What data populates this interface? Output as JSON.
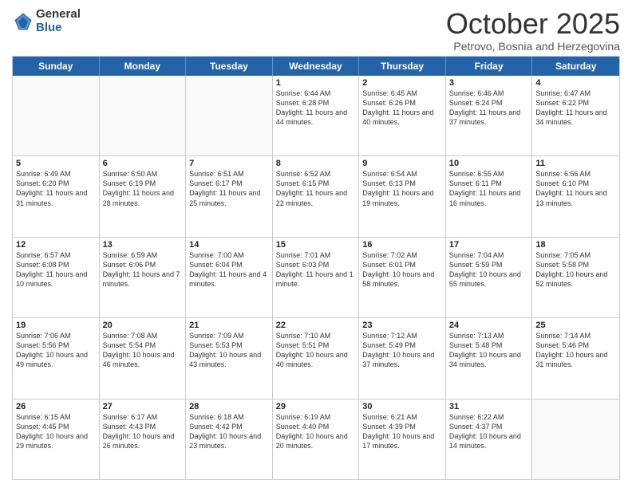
{
  "logo": {
    "general": "General",
    "blue": "Blue"
  },
  "header": {
    "month": "October 2025",
    "location": "Petrovo, Bosnia and Herzegovina"
  },
  "days": [
    "Sunday",
    "Monday",
    "Tuesday",
    "Wednesday",
    "Thursday",
    "Friday",
    "Saturday"
  ],
  "weeks": [
    [
      {
        "day": "",
        "text": ""
      },
      {
        "day": "",
        "text": ""
      },
      {
        "day": "",
        "text": ""
      },
      {
        "day": "1",
        "text": "Sunrise: 6:44 AM\nSunset: 6:28 PM\nDaylight: 11 hours and 44 minutes."
      },
      {
        "day": "2",
        "text": "Sunrise: 6:45 AM\nSunset: 6:26 PM\nDaylight: 11 hours and 40 minutes."
      },
      {
        "day": "3",
        "text": "Sunrise: 6:46 AM\nSunset: 6:24 PM\nDaylight: 11 hours and 37 minutes."
      },
      {
        "day": "4",
        "text": "Sunrise: 6:47 AM\nSunset: 6:22 PM\nDaylight: 11 hours and 34 minutes."
      }
    ],
    [
      {
        "day": "5",
        "text": "Sunrise: 6:49 AM\nSunset: 6:20 PM\nDaylight: 11 hours and 31 minutes."
      },
      {
        "day": "6",
        "text": "Sunrise: 6:50 AM\nSunset: 6:19 PM\nDaylight: 11 hours and 28 minutes."
      },
      {
        "day": "7",
        "text": "Sunrise: 6:51 AM\nSunset: 6:17 PM\nDaylight: 11 hours and 25 minutes."
      },
      {
        "day": "8",
        "text": "Sunrise: 6:52 AM\nSunset: 6:15 PM\nDaylight: 11 hours and 22 minutes."
      },
      {
        "day": "9",
        "text": "Sunrise: 6:54 AM\nSunset: 6:13 PM\nDaylight: 11 hours and 19 minutes."
      },
      {
        "day": "10",
        "text": "Sunrise: 6:55 AM\nSunset: 6:11 PM\nDaylight: 11 hours and 16 minutes."
      },
      {
        "day": "11",
        "text": "Sunrise: 6:56 AM\nSunset: 6:10 PM\nDaylight: 11 hours and 13 minutes."
      }
    ],
    [
      {
        "day": "12",
        "text": "Sunrise: 6:57 AM\nSunset: 6:08 PM\nDaylight: 11 hours and 10 minutes."
      },
      {
        "day": "13",
        "text": "Sunrise: 6:59 AM\nSunset: 6:06 PM\nDaylight: 11 hours and 7 minutes."
      },
      {
        "day": "14",
        "text": "Sunrise: 7:00 AM\nSunset: 6:04 PM\nDaylight: 11 hours and 4 minutes."
      },
      {
        "day": "15",
        "text": "Sunrise: 7:01 AM\nSunset: 6:03 PM\nDaylight: 11 hours and 1 minute."
      },
      {
        "day": "16",
        "text": "Sunrise: 7:02 AM\nSunset: 6:01 PM\nDaylight: 10 hours and 58 minutes."
      },
      {
        "day": "17",
        "text": "Sunrise: 7:04 AM\nSunset: 5:59 PM\nDaylight: 10 hours and 55 minutes."
      },
      {
        "day": "18",
        "text": "Sunrise: 7:05 AM\nSunset: 5:58 PM\nDaylight: 10 hours and 52 minutes."
      }
    ],
    [
      {
        "day": "19",
        "text": "Sunrise: 7:06 AM\nSunset: 5:56 PM\nDaylight: 10 hours and 49 minutes."
      },
      {
        "day": "20",
        "text": "Sunrise: 7:08 AM\nSunset: 5:54 PM\nDaylight: 10 hours and 46 minutes."
      },
      {
        "day": "21",
        "text": "Sunrise: 7:09 AM\nSunset: 5:53 PM\nDaylight: 10 hours and 43 minutes."
      },
      {
        "day": "22",
        "text": "Sunrise: 7:10 AM\nSunset: 5:51 PM\nDaylight: 10 hours and 40 minutes."
      },
      {
        "day": "23",
        "text": "Sunrise: 7:12 AM\nSunset: 5:49 PM\nDaylight: 10 hours and 37 minutes."
      },
      {
        "day": "24",
        "text": "Sunrise: 7:13 AM\nSunset: 5:48 PM\nDaylight: 10 hours and 34 minutes."
      },
      {
        "day": "25",
        "text": "Sunrise: 7:14 AM\nSunset: 5:46 PM\nDaylight: 10 hours and 31 minutes."
      }
    ],
    [
      {
        "day": "26",
        "text": "Sunrise: 6:15 AM\nSunset: 4:45 PM\nDaylight: 10 hours and 29 minutes."
      },
      {
        "day": "27",
        "text": "Sunrise: 6:17 AM\nSunset: 4:43 PM\nDaylight: 10 hours and 26 minutes."
      },
      {
        "day": "28",
        "text": "Sunrise: 6:18 AM\nSunset: 4:42 PM\nDaylight: 10 hours and 23 minutes."
      },
      {
        "day": "29",
        "text": "Sunrise: 6:19 AM\nSunset: 4:40 PM\nDaylight: 10 hours and 20 minutes."
      },
      {
        "day": "30",
        "text": "Sunrise: 6:21 AM\nSunset: 4:39 PM\nDaylight: 10 hours and 17 minutes."
      },
      {
        "day": "31",
        "text": "Sunrise: 6:22 AM\nSunset: 4:37 PM\nDaylight: 10 hours and 14 minutes."
      },
      {
        "day": "",
        "text": ""
      }
    ]
  ]
}
